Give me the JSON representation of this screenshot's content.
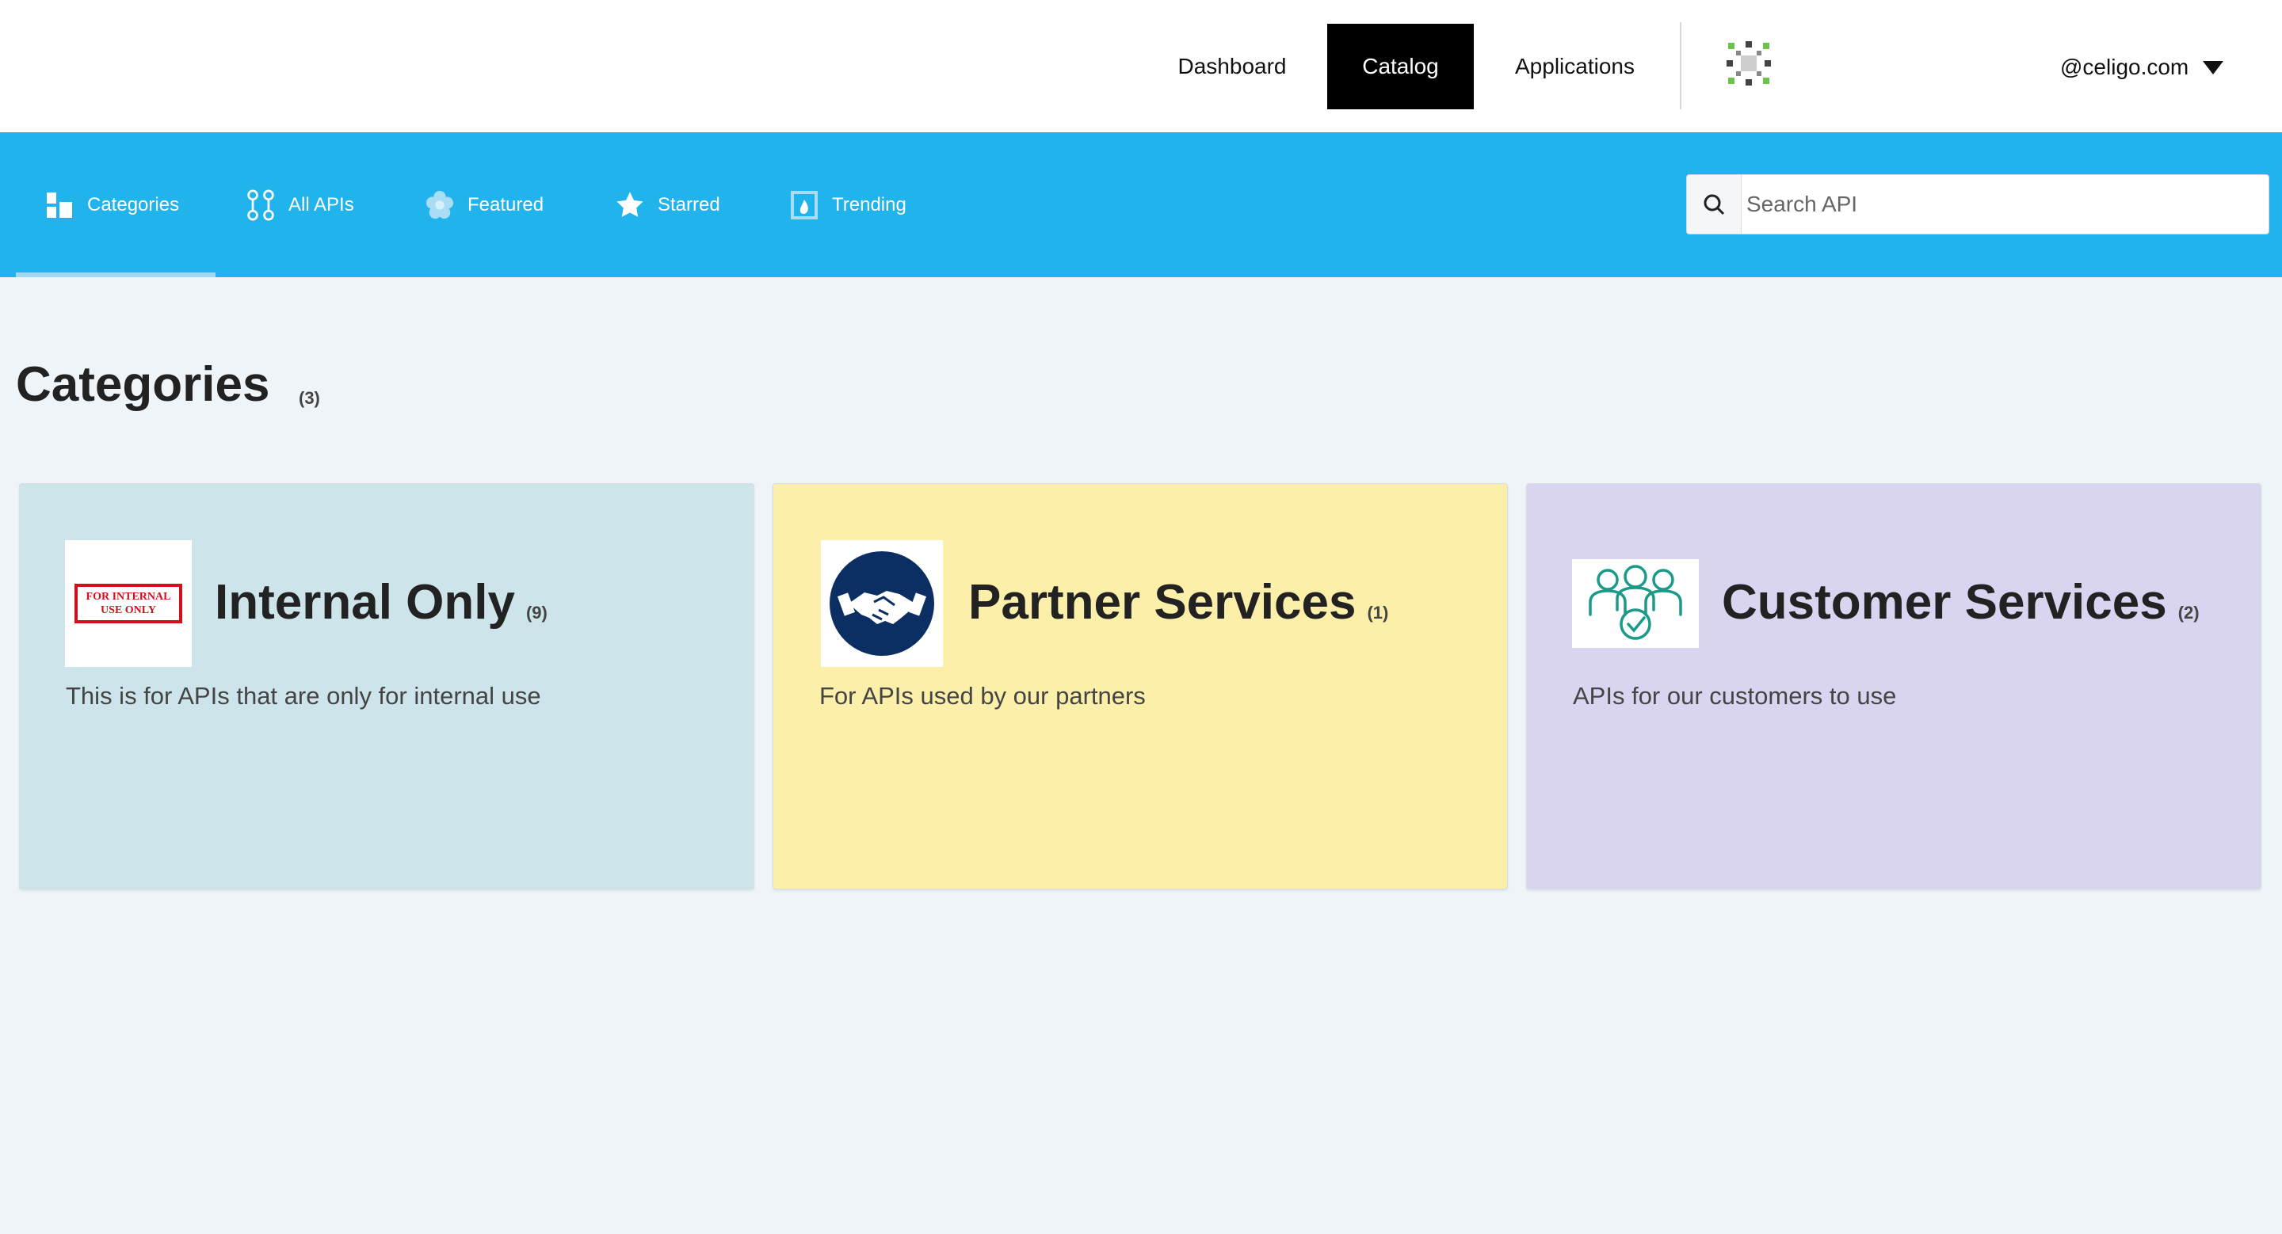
{
  "header": {
    "nav": [
      {
        "label": "Dashboard"
      },
      {
        "label": "Catalog",
        "active": true
      },
      {
        "label": "Applications"
      }
    ],
    "user": "@celigo.com"
  },
  "subnav": {
    "tabs": [
      {
        "label": "Categories",
        "icon": "categories-icon",
        "active": true
      },
      {
        "label": "All APIs",
        "icon": "all-apis-icon"
      },
      {
        "label": "Featured",
        "icon": "featured-flower-icon"
      },
      {
        "label": "Starred",
        "icon": "star-icon"
      },
      {
        "label": "Trending",
        "icon": "trending-flame-icon"
      }
    ],
    "search_placeholder": "Search API"
  },
  "page": {
    "title": "Categories",
    "count": "(3)"
  },
  "cards": [
    {
      "title": "Internal Only",
      "count": "(9)",
      "description": "This is for APIs that are only for internal use",
      "logo_text": "FOR INTERNAL USE ONLY",
      "bg": "#cce4ea"
    },
    {
      "title": "Partner Services",
      "count": "(1)",
      "description": "For APIs used by our partners",
      "bg": "#fcefa9"
    },
    {
      "title": "Customer Services",
      "count": "(2)",
      "description": "APIs for our customers to use",
      "bg": "#d9d5f0"
    }
  ],
  "colors": {
    "accent": "#20b3ec",
    "active_nav_bg": "#000000",
    "page_bg": "#eff4f8"
  }
}
